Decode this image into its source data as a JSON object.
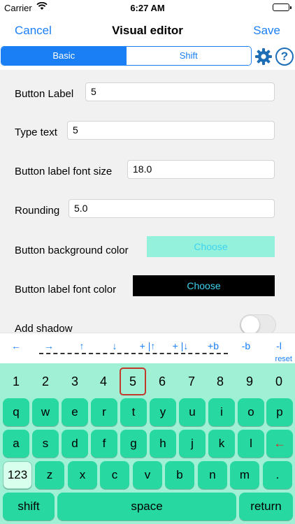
{
  "status": {
    "carrier": "Carrier",
    "time": "6:27 AM"
  },
  "nav": {
    "cancel": "Cancel",
    "title": "Visual editor",
    "save": "Save"
  },
  "segments": [
    {
      "label": "Basic",
      "selected": true
    },
    {
      "label": "Shift",
      "selected": false
    }
  ],
  "help_glyph": "?",
  "form": {
    "button_label": {
      "label": "Button Label",
      "value": "5"
    },
    "type_text": {
      "label": "Type text",
      "value": "5"
    },
    "font_size": {
      "label": "Button label font size",
      "value": "18.0"
    },
    "rounding": {
      "label": "Rounding",
      "value": "5.0"
    },
    "bg_color": {
      "label": "Button background color",
      "button": "Choose",
      "color": "#94f2dc"
    },
    "font_color": {
      "label": "Button label font color",
      "button": "Choose",
      "color": "#000000"
    },
    "shadow": {
      "label": "Add shadow",
      "on": false
    }
  },
  "arrows": [
    "←",
    "→",
    "↑",
    "↓",
    "+ |↑",
    "+ |↓",
    "+b",
    "-b",
    "-l"
  ],
  "reset": "reset",
  "keyboard": {
    "numbers": [
      "1",
      "2",
      "3",
      "4",
      "5",
      "6",
      "7",
      "8",
      "9",
      "0"
    ],
    "selected_number": "5",
    "row1": [
      "q",
      "w",
      "e",
      "r",
      "t",
      "y",
      "u",
      "i",
      "o",
      "p"
    ],
    "row2": [
      "a",
      "s",
      "d",
      "f",
      "g",
      "h",
      "j",
      "k",
      "l",
      "←"
    ],
    "row3": [
      "123",
      "z",
      "x",
      "c",
      "v",
      "b",
      "n",
      "m",
      "."
    ],
    "row4": [
      "shift",
      "space",
      "return"
    ],
    "key_color": "#27d8a0",
    "background_color": "#a0f0d6"
  }
}
